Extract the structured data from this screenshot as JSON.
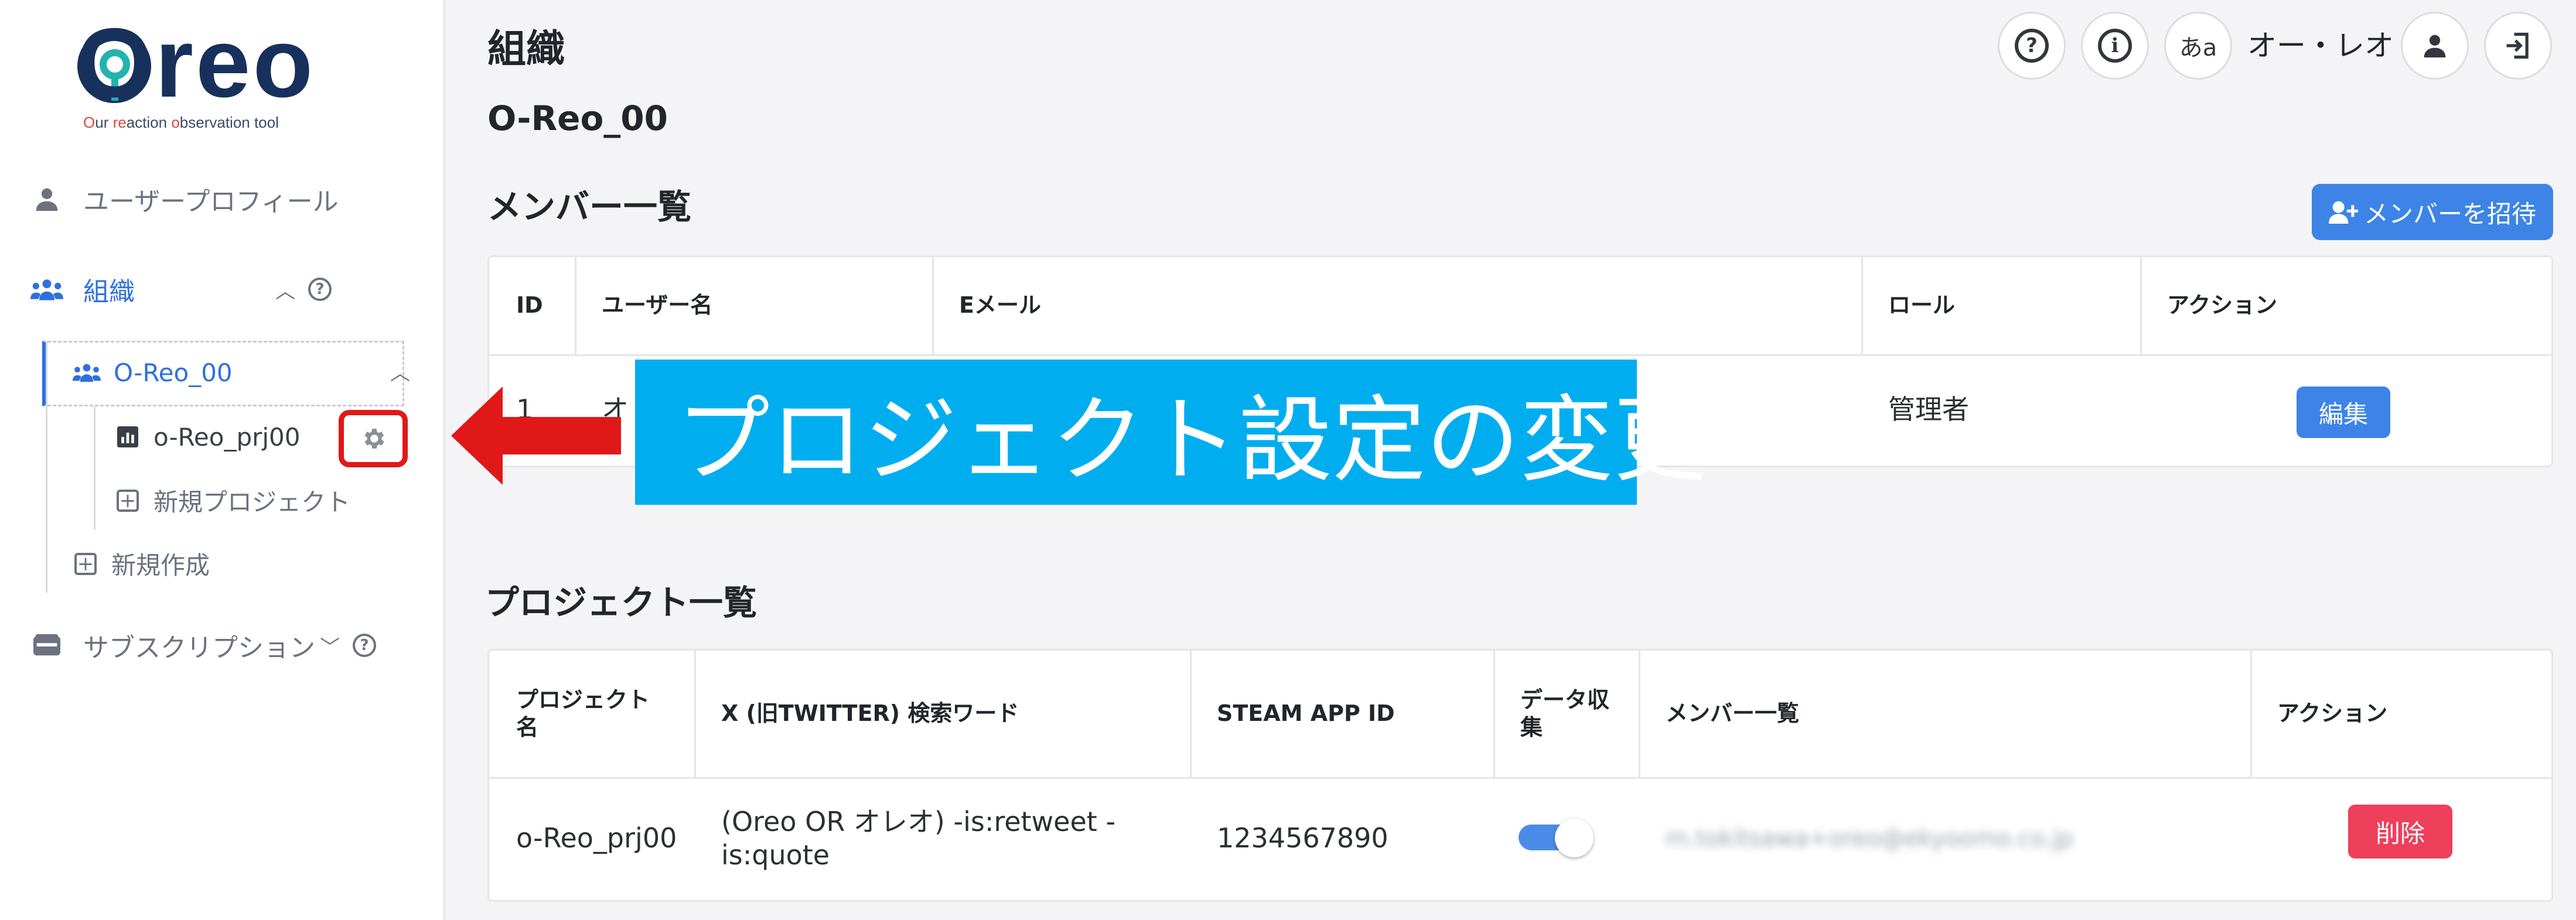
{
  "brand": {
    "logo_text": "Oreo",
    "tagline_parts": [
      "O",
      "ur ",
      "re",
      "action ",
      "o",
      "bservation tool"
    ]
  },
  "sidebar": {
    "profile_label": "ユーザープロフィール",
    "org_label": "組織",
    "org_item": "O-Reo_00",
    "project_item": "o-Reo_prj00",
    "new_project": "新規プロジェクト",
    "new_create": "新規作成",
    "subscription_label": "サブスクリプション"
  },
  "header": {
    "title": "組織",
    "help_icon": "?",
    "info_icon": "i",
    "lang_label": "あa",
    "user_name": "オー・レオ"
  },
  "org_name": "O-Reo_00",
  "members": {
    "section_title": "メンバー一覧",
    "invite_button": "メンバーを招待",
    "columns": [
      "ID",
      "ユーザー名",
      "Eメール",
      "ロール",
      "アクション"
    ],
    "rows": [
      {
        "id": "1",
        "username": "オ",
        "email": "",
        "role": "管理者",
        "action": "編集"
      }
    ]
  },
  "projects": {
    "section_title": "プロジェクト一覧",
    "columns": [
      "プロジェクト名",
      "X (旧TWITTER) 検索ワード",
      "STEAM APP ID",
      "データ収集",
      "メンバー一覧",
      "アクション"
    ],
    "rows": [
      {
        "name": "o-Reo_prj00",
        "search_word": "(Oreo OR オレオ) -is:retweet -is:quote",
        "steam_app_id": "1234567890",
        "data_collection_on": true,
        "members_blurred": "m.tokitsawa+oreo@ekyoomo.co.jp",
        "action": "削除"
      }
    ]
  },
  "annotation": {
    "callout_text": "プロジェクト設定の変更",
    "arrow_color": "#e01818",
    "callout_color": "#00aeef"
  },
  "colors": {
    "accent": "#2f6fe0",
    "primary_button": "#3d84e6",
    "danger_button": "#ee3f5b",
    "brand_navy": "#18305c",
    "brand_teal": "#23b3ad"
  }
}
